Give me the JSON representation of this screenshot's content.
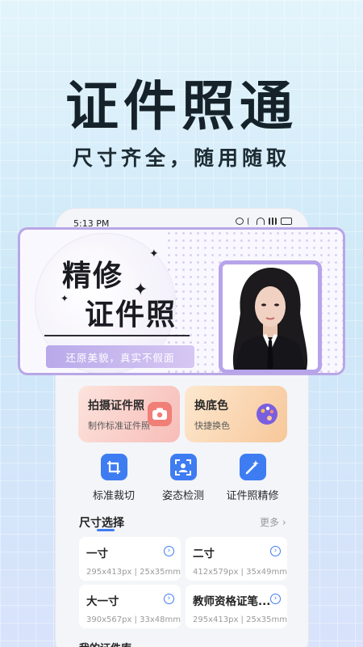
{
  "hero": {
    "title": "证件照通",
    "subtitle": "尺寸齐全，随用随取"
  },
  "status_bar": {
    "time": "5:13 PM"
  },
  "banner": {
    "line1": "精修",
    "line2": "证件照",
    "tag": "还原美貌，真实不假面"
  },
  "features": [
    {
      "title": "拍摄证件照",
      "subtitle": "制作标准证件照",
      "icon": "camera-icon"
    },
    {
      "title": "换底色",
      "subtitle": "快捷换色",
      "icon": "palette-icon"
    }
  ],
  "tools": [
    {
      "label": "标准裁切",
      "icon": "crop-icon"
    },
    {
      "label": "姿态检测",
      "icon": "portrait-scan-icon"
    },
    {
      "label": "证件照精修",
      "icon": "magic-wand-icon"
    }
  ],
  "size_section": {
    "title": "尺寸选择",
    "more": "更多 ›"
  },
  "sizes": [
    {
      "name": "一寸",
      "px": "295x413px",
      "mm": "25x35mm"
    },
    {
      "name": "二寸",
      "px": "412x579px",
      "mm": "35x49mm"
    },
    {
      "name": "大一寸",
      "px": "390x567px",
      "mm": "33x48mm"
    },
    {
      "name": "教师资格证笔...",
      "px": "295x413px",
      "mm": "25x35mm"
    }
  ],
  "bottom_section": {
    "title": "我的证件库"
  },
  "colors": {
    "accent": "#3e7cf2",
    "banner_border": "#b9a6e6",
    "tag_bg": "#c1b1ee"
  }
}
